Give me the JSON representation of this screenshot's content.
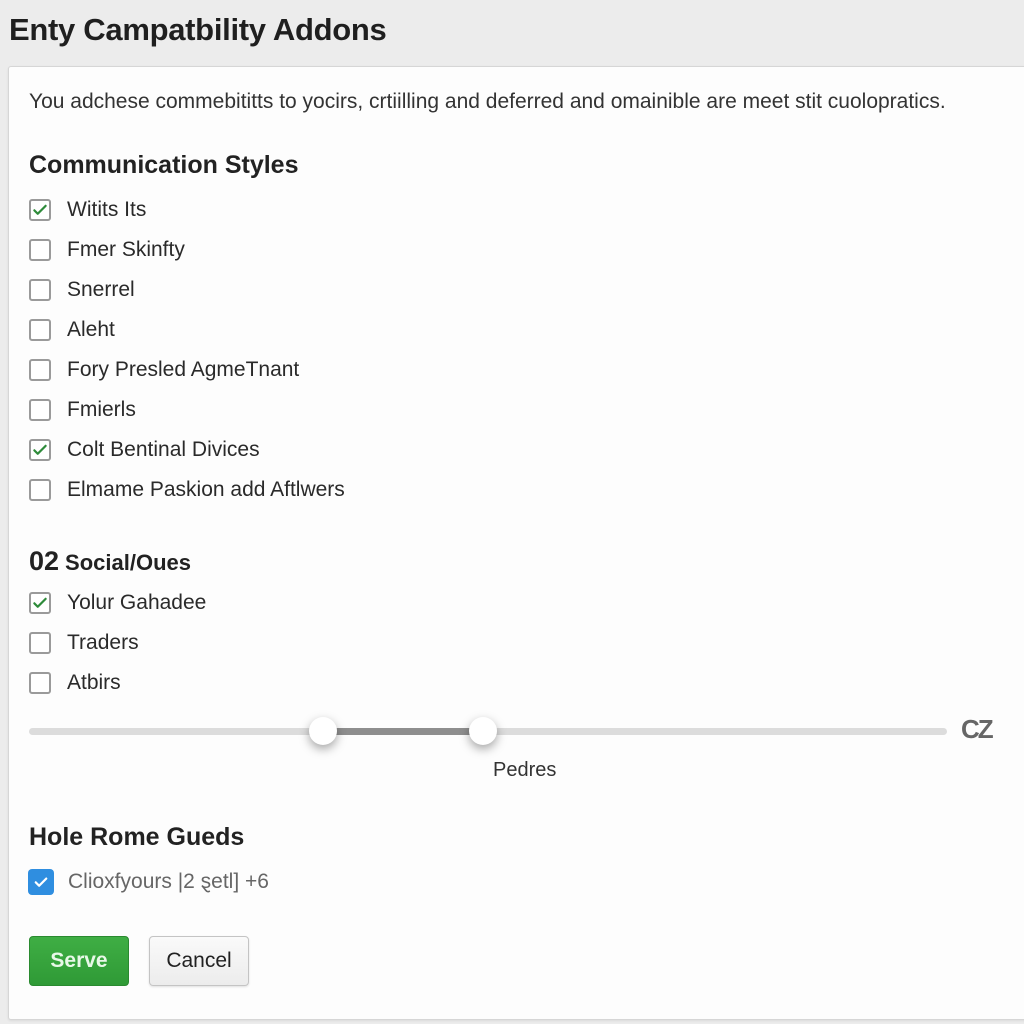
{
  "page": {
    "title": "Enty Campatbility Addons"
  },
  "card": {
    "description": "You adchese commebititts to yocirs, crtiilling and deferred and omainible are meet stit cuolopratics."
  },
  "sections": {
    "communication": {
      "title": "Communication Styles",
      "items": [
        {
          "label": "Witits Its",
          "checked": true
        },
        {
          "label": "Fmer Skinfty",
          "checked": false
        },
        {
          "label": "Snerrel",
          "checked": false
        },
        {
          "label": "Aleht",
          "checked": false
        },
        {
          "label": "Fory Presled AgmeTnant",
          "checked": false
        },
        {
          "label": "Fmierls",
          "checked": false
        },
        {
          "label": "Colt Bentinal Divices",
          "checked": true
        },
        {
          "label": "Elmame Paskion add Aftlwers",
          "checked": false
        }
      ]
    },
    "social": {
      "number": "02",
      "title": "Social/Oues",
      "items": [
        {
          "label": "Yolur Gahadee",
          "checked": true
        },
        {
          "label": "Traders",
          "checked": false
        },
        {
          "label": "Atbirs",
          "checked": false
        }
      ]
    },
    "range": {
      "low_fraction": 0.32,
      "high_fraction": 0.495,
      "end_label": "CZ",
      "caption": "Pedres"
    },
    "home": {
      "title": "Hole Rome Gueds",
      "item": {
        "label": "Clioxfyours |2 ȿetl] +6",
        "checked": true
      }
    }
  },
  "buttons": {
    "save": "Serve",
    "cancel": "Cancel"
  },
  "colors": {
    "check_green": "#2e8b3a",
    "check_blue": "#2f8ee0",
    "primary_button": "#34a33a"
  }
}
